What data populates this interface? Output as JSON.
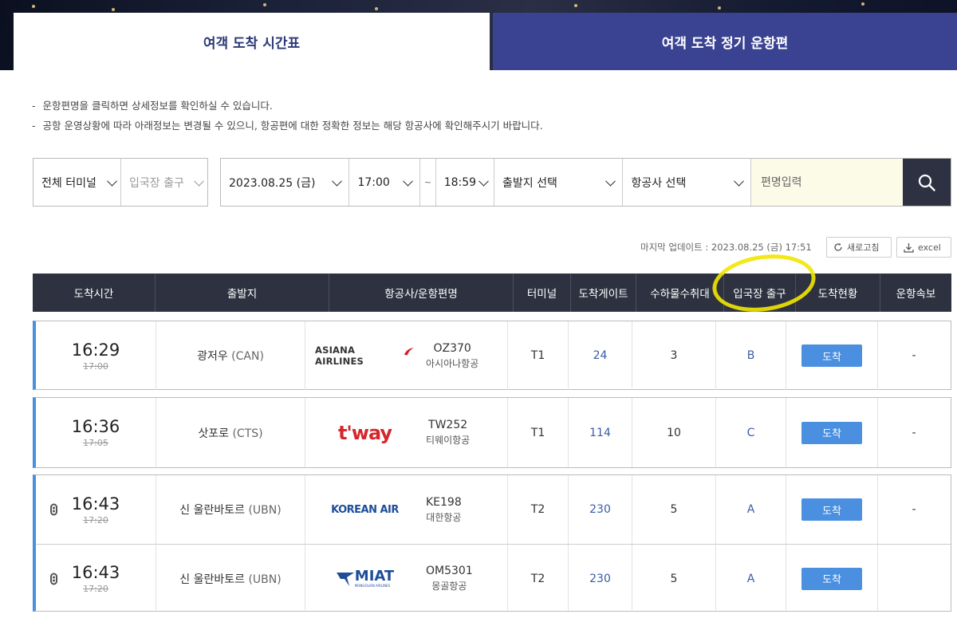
{
  "tabs": [
    {
      "label": "여객 도착 시간표",
      "active": true
    },
    {
      "label": "여객 도착 정기 운항편",
      "active": false
    }
  ],
  "notices": [
    "운항편명을 클릭하면 상세정보를 확인하실 수 있습니다.",
    "공항 운영상황에 따라 아래정보는 변경될 수 있으니, 항공편에 대한 정확한 정보는 해당 항공사에 확인해주시기 바랍니다."
  ],
  "filters": {
    "terminal": "전체 터미널",
    "exit": "입국장 출구",
    "date": "2023.08.25 (금)",
    "time_from": "17:00",
    "tilde": "~",
    "time_to": "18:59",
    "origin": "출발지 선택",
    "airline": "항공사 선택",
    "flight_placeholder": "편명입력"
  },
  "update": {
    "text": "마지막 업데이트 : 2023.08.25 (금) 17:51",
    "refresh_label": "새로고침",
    "excel_label": "excel"
  },
  "table": {
    "headers": [
      "도착시간",
      "출발지",
      "항공사/운항편명",
      "터미널",
      "도착게이트",
      "수하물수취대",
      "입국장 출구",
      "도착현황",
      "운항속보"
    ],
    "rows": [
      {
        "time": "16:29",
        "scheduled": "17:00",
        "origin": "광저우",
        "origin_code": "(CAN)",
        "logo": "ASIANA AIRLINES",
        "flight": "OZ370",
        "airline": "아시아나항공",
        "terminal": "T1",
        "gate": "24",
        "carousel": "3",
        "exit": "B",
        "status": "도착",
        "notice": "-"
      },
      {
        "time": "16:36",
        "scheduled": "17:05",
        "origin": "삿포로",
        "origin_code": "(CTS)",
        "logo": "t'way",
        "flight": "TW252",
        "airline": "티웨이항공",
        "terminal": "T1",
        "gate": "114",
        "carousel": "10",
        "exit": "C",
        "status": "도착",
        "notice": "-"
      },
      {
        "time": "16:43",
        "scheduled": "17:20",
        "origin": "신 울란바토르",
        "origin_code": "(UBN)",
        "logo": "KOREAN AIR",
        "flight": "KE198",
        "airline": "대한항공",
        "terminal": "T2",
        "gate": "230",
        "carousel": "5",
        "exit": "A",
        "status": "도착",
        "notice": "-"
      },
      {
        "time": "16:43",
        "scheduled": "17:20",
        "origin": "신 울란바토르",
        "origin_code": "(UBN)",
        "logo": "MIAT",
        "logo_sub": "MONGOLIAN AIRLINES",
        "flight": "OM5301",
        "airline": "몽골항공",
        "terminal": "T2",
        "gate": "230",
        "carousel": "5",
        "exit": "A",
        "status": "도착",
        "notice": ""
      }
    ]
  },
  "colors": {
    "accent": "#3a4292",
    "header_bg": "#2e3240",
    "status_blue": "#4a8fe0",
    "highlight": "#f2e600"
  }
}
